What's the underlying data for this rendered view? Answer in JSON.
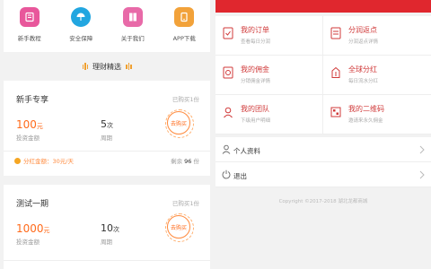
{
  "left": {
    "icons": [
      {
        "label": "新手教程",
        "icon": "book-icon",
        "color": "#e8579b"
      },
      {
        "label": "安全保障",
        "icon": "umbrella-icon",
        "color": "#22a6e0"
      },
      {
        "label": "关于我们",
        "icon": "document-icon",
        "color": "#e86aa8"
      },
      {
        "label": "APP下载",
        "icon": "download-icon",
        "color": "#f2a23a"
      }
    ],
    "section_title": "理财精选",
    "cards": [
      {
        "title": "新手专享",
        "sold": "已购买1份",
        "amount": "100",
        "amount_unit": "元",
        "amount_label": "投资金额",
        "period": "5",
        "period_unit": "次",
        "period_label": "周期",
        "buy": "去购买",
        "dividend": "分红金额：30元/天",
        "remaining_label": "剩余",
        "remaining_value": "96",
        "remaining_unit": "份"
      },
      {
        "title": "测试一期",
        "sold": "已购买1份",
        "amount": "1000",
        "amount_unit": "元",
        "amount_label": "投资金额",
        "period": "10",
        "period_unit": "次",
        "period_label": "周期",
        "buy": "去购买"
      }
    ]
  },
  "right": {
    "accent": "#e0272e",
    "grid": [
      {
        "title": "我的订单",
        "sub": "查看每日分润",
        "icon": "order-icon"
      },
      {
        "title": "分润返点",
        "sub": "分润返点详情",
        "icon": "rebate-icon"
      },
      {
        "title": "我的佣金",
        "sub": "分销佣金详情",
        "icon": "commission-icon"
      },
      {
        "title": "全球分红",
        "sub": "每日流水分红",
        "icon": "dividend-icon"
      },
      {
        "title": "我的团队",
        "sub": "下级用户明细",
        "icon": "team-icon"
      },
      {
        "title": "我的二维码",
        "sub": "邀请来永久佣金",
        "icon": "qrcode-icon"
      }
    ],
    "list": [
      {
        "label": "个人资料",
        "icon": "user-icon"
      },
      {
        "label": "退出",
        "icon": "logout-icon"
      }
    ],
    "copyright": "Copyright ©2017-2018 湖北龙都商城"
  }
}
